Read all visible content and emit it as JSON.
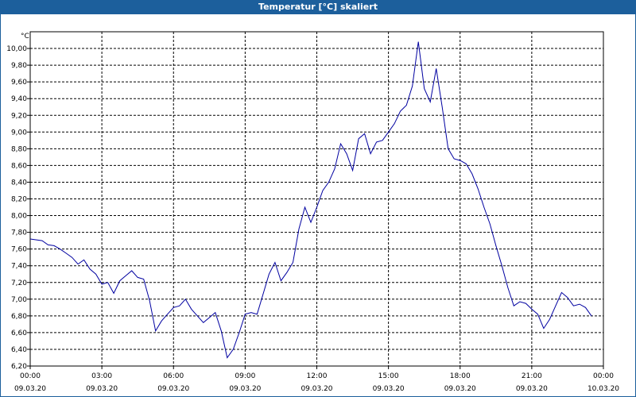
{
  "window": {
    "title": "Temperatur [°C] skaliert"
  },
  "chart_data": {
    "type": "line",
    "title": "Temperatur [°C] skaliert",
    "unit_label": "°C",
    "ylim": [
      6.2,
      10.2
    ],
    "y_ticks": [
      "6,20",
      "6,40",
      "6,60",
      "6,80",
      "7,00",
      "7,20",
      "7,40",
      "7,60",
      "7,80",
      "8,00",
      "8,20",
      "8,40",
      "8,60",
      "8,80",
      "9,00",
      "9,20",
      "9,40",
      "9,60",
      "9,80",
      "10,00"
    ],
    "x_ticks": [
      {
        "time": "00:00",
        "date": "09.03.20"
      },
      {
        "time": "03:00",
        "date": "09.03.20"
      },
      {
        "time": "06:00",
        "date": "09.03.20"
      },
      {
        "time": "09:00",
        "date": "09.03.20"
      },
      {
        "time": "12:00",
        "date": "09.03.20"
      },
      {
        "time": "15:00",
        "date": "09.03.20"
      },
      {
        "time": "18:00",
        "date": "09.03.20"
      },
      {
        "time": "21:00",
        "date": "09.03.20"
      },
      {
        "time": "00:00",
        "date": "10.03.20"
      }
    ],
    "xlim_hours": [
      0,
      24
    ],
    "grid": true,
    "line_color": "#0000a0",
    "series": [
      {
        "x_hours": [
          0,
          0.5,
          0.75,
          1,
          1.25,
          1.5,
          1.75,
          2,
          2.25,
          2.5,
          2.75,
          3,
          3.25,
          3.5,
          3.75,
          4,
          4.25,
          4.5,
          4.75,
          5,
          5.25,
          5.5,
          5.75,
          6,
          6.25,
          6.5,
          6.75,
          7,
          7.25,
          7.5,
          7.75,
          8,
          8.25,
          8.5,
          8.75,
          9,
          9.25,
          9.5,
          9.75,
          10,
          10.25,
          10.5,
          10.75,
          11,
          11.25,
          11.5,
          11.75,
          12,
          12.25,
          12.5,
          12.75,
          13,
          13.25,
          13.5,
          13.75,
          14,
          14.25,
          14.5,
          14.75,
          15,
          15.25,
          15.5,
          15.75,
          16,
          16.25,
          16.5,
          16.75,
          17,
          17.25,
          17.5,
          17.75,
          18,
          18.25,
          18.5,
          18.75,
          19,
          19.25,
          19.5,
          19.75,
          20,
          20.25,
          20.5,
          20.75,
          21,
          21.25,
          21.5,
          21.75,
          22,
          22.25,
          22.5,
          22.75,
          23,
          23.25,
          23.5,
          23.75,
          24
        ],
        "values": [
          7.72,
          7.7,
          7.65,
          7.64,
          7.6,
          7.55,
          7.5,
          7.42,
          7.47,
          7.36,
          7.3,
          7.18,
          7.2,
          7.07,
          7.22,
          7.28,
          7.34,
          7.26,
          7.24,
          6.98,
          6.62,
          6.74,
          6.82,
          6.9,
          6.92,
          7.0,
          6.88,
          6.8,
          6.72,
          6.78,
          6.84,
          6.62,
          6.3,
          6.4,
          6.6,
          6.82,
          6.84,
          6.82,
          7.06,
          7.3,
          7.44,
          7.22,
          7.32,
          7.44,
          7.84,
          8.1,
          7.92,
          8.1,
          8.3,
          8.4,
          8.56,
          8.86,
          8.74,
          8.54,
          8.92,
          8.98,
          8.74,
          8.88,
          8.9,
          9.0,
          9.1,
          9.25,
          9.32,
          9.55,
          10.08,
          9.52,
          9.36,
          9.76,
          9.3,
          8.8,
          8.68,
          8.66,
          8.62,
          8.5,
          8.32,
          8.1,
          7.9,
          7.64,
          7.4,
          7.14,
          6.92,
          6.97,
          6.95,
          6.88,
          6.82,
          6.65,
          6.76,
          6.92,
          7.08,
          7.02,
          6.92,
          6.94,
          6.9,
          6.8
        ]
      }
    ]
  }
}
